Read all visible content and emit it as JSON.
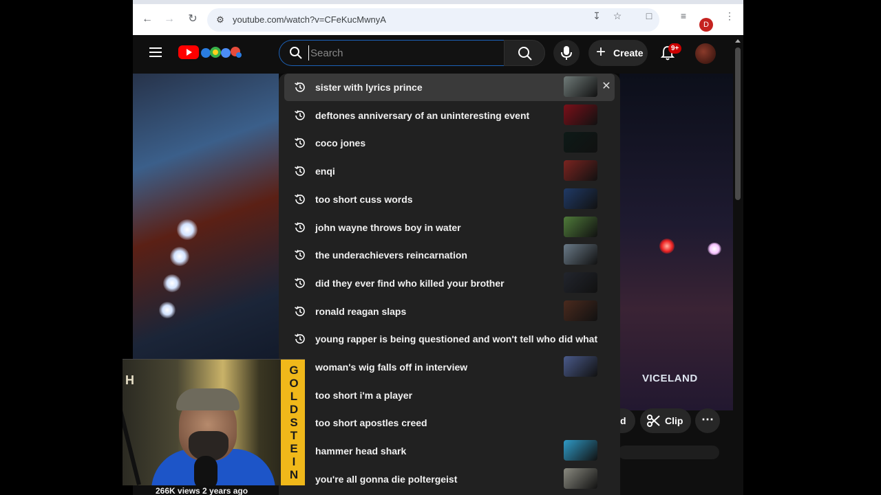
{
  "browser": {
    "url": "youtube.com/watch?v=CFeKucMwnyA",
    "profile_initial": "D"
  },
  "header": {
    "search_placeholder": "Search",
    "create_label": "Create",
    "notifications_badge": "9+"
  },
  "suggestions": [
    {
      "text": "sister with lyrics prince",
      "thumb": "#6f7a78"
    },
    {
      "text": "deftones anniversary of an uninteresting event",
      "thumb": "#7a1019"
    },
    {
      "text": "coco jones",
      "thumb": "#0d1a17"
    },
    {
      "text": "enqi",
      "thumb": "#7a2420"
    },
    {
      "text": "too short cuss words",
      "thumb": "#203a66"
    },
    {
      "text": "john wayne throws boy in water",
      "thumb": "#4f7a3a"
    },
    {
      "text": "the underachievers reincarnation",
      "thumb": "#6a7a88"
    },
    {
      "text": "did they ever find who killed your brother",
      "thumb": "#22252d"
    },
    {
      "text": "ronald reagan slaps",
      "thumb": "#4a2a1e"
    },
    {
      "text": "young rapper is being questioned and won't tell who did what",
      "thumb": null
    },
    {
      "text": "woman's wig falls off in interview",
      "thumb": "#4a5a8a"
    },
    {
      "text": "too short i'm a player",
      "thumb": null
    },
    {
      "text": "too short apostles creed",
      "thumb": null
    },
    {
      "text": "hammer head shark",
      "thumb": "#2f9ac6"
    },
    {
      "text": "you're all gonna die poltergeist",
      "thumb": "#8a8a80"
    }
  ],
  "player": {
    "watermark": "VICELAND",
    "clip_label": "Clip",
    "partial_label": "d",
    "views_text": "266K views  2 years ago"
  },
  "webcam": {
    "letter": "H",
    "banner": [
      "G",
      "O",
      "L",
      "D",
      "S",
      "T",
      "E",
      "I",
      "N"
    ]
  },
  "colors": {
    "yt_red": "#ff0000",
    "search_focus": "#1c62b9",
    "dropdown_bg": "#212121",
    "page_bg": "#0f0f0f"
  }
}
